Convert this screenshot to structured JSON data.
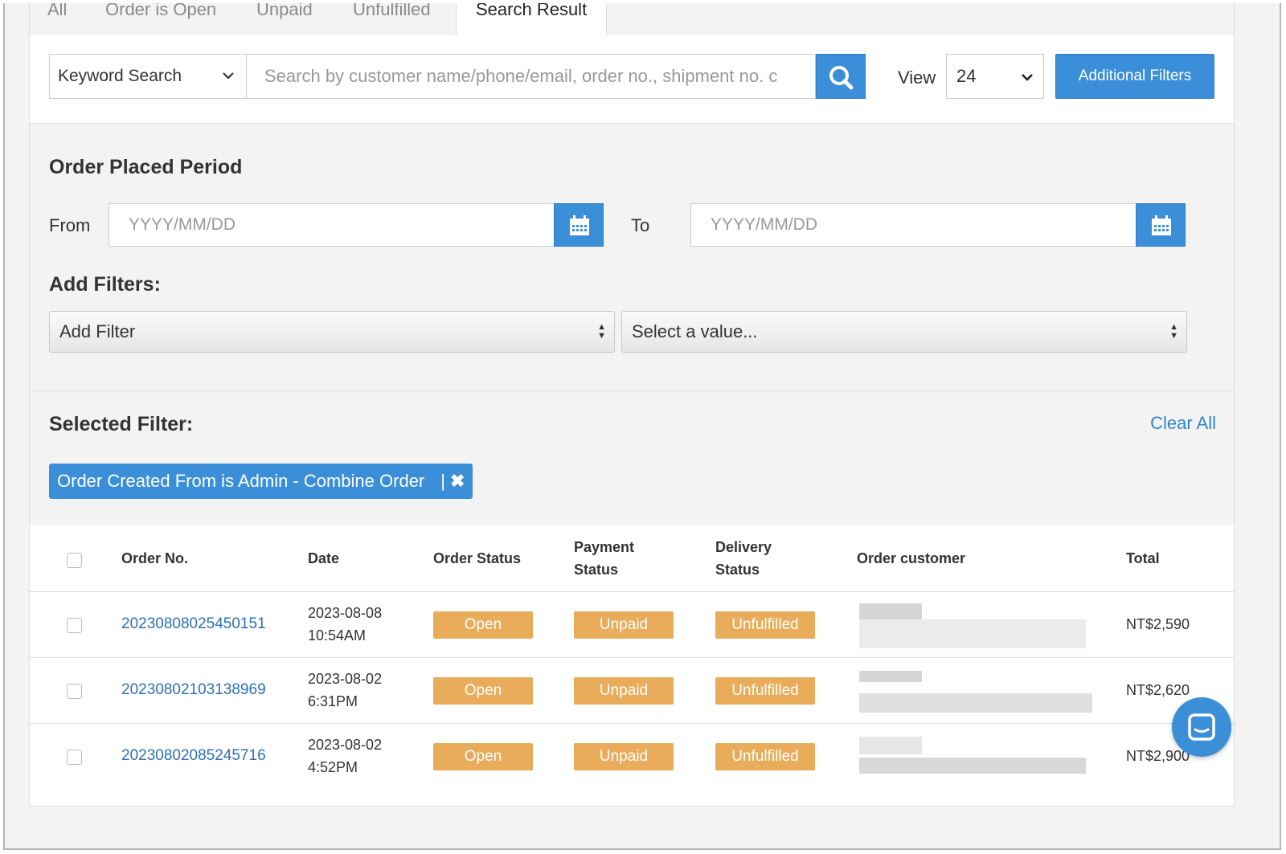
{
  "tabs": [
    {
      "label": "All"
    },
    {
      "label": "Order is Open"
    },
    {
      "label": "Unpaid"
    },
    {
      "label": "Unfulfilled"
    },
    {
      "label": "Search Result"
    }
  ],
  "search": {
    "keyword_select": "Keyword Search",
    "placeholder": "Search by customer name/phone/email, order no., shipment no. c",
    "view_label": "View",
    "view_value": "24",
    "additional_filters": "Additional Filters"
  },
  "period": {
    "title": "Order Placed Period",
    "from_label": "From",
    "to_label": "To",
    "date_placeholder": "YYYY/MM/DD"
  },
  "add_filters": {
    "title": "Add Filters:",
    "filter_select": "Add Filter",
    "value_select": "Select a value..."
  },
  "selected": {
    "title": "Selected Filter:",
    "clear_all": "Clear All",
    "chip_label": "Order Created From is Admin - Combine Order",
    "chip_sep": "|",
    "chip_close": "✖"
  },
  "table": {
    "headers": {
      "order_no": "Order No.",
      "date": "Date",
      "order_status": "Order Status",
      "payment_status_1": "Payment",
      "payment_status_2": "Status",
      "delivery_status_1": "Delivery",
      "delivery_status_2": "Status",
      "order_customer": "Order customer",
      "total": "Total"
    },
    "rows": [
      {
        "order_no": "20230808025450151",
        "date": "2023-08-08",
        "time": "10:54AM",
        "order_status": "Open",
        "payment_status": "Unpaid",
        "delivery_status": "Unfulfilled",
        "total": "NT$2,590"
      },
      {
        "order_no": "20230802103138969",
        "date": "2023-08-02",
        "time": "6:31PM",
        "order_status": "Open",
        "payment_status": "Unpaid",
        "delivery_status": "Unfulfilled",
        "total": "NT$2,620"
      },
      {
        "order_no": "20230802085245716",
        "date": "2023-08-02",
        "time": "4:52PM",
        "order_status": "Open",
        "payment_status": "Unpaid",
        "delivery_status": "Unfulfilled",
        "total": "NT$2,900"
      }
    ]
  },
  "colors": {
    "accent": "#3b8ed8",
    "link": "#2f6fb5",
    "badge": "#e8ac5a"
  },
  "icons": [
    "search-icon",
    "calendar-icon",
    "chevron-down-icon",
    "close-icon",
    "chat-icon"
  ]
}
